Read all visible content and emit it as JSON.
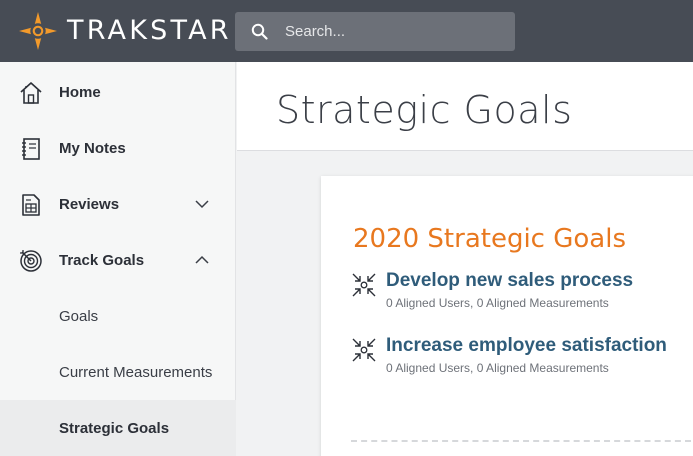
{
  "header": {
    "brand": "TRAKSTAR",
    "search_placeholder": "Search...",
    "colors": {
      "bar": "#474c55",
      "logo": "#f39a2b"
    }
  },
  "sidebar": {
    "items": [
      {
        "label": "Home",
        "icon": "home-icon"
      },
      {
        "label": "My Notes",
        "icon": "notebook-icon"
      },
      {
        "label": "Reviews",
        "icon": "review-icon",
        "chevron": "chevron-down-icon"
      },
      {
        "label": "Track Goals",
        "icon": "target-icon",
        "chevron": "chevron-up-icon"
      }
    ],
    "subitems": [
      {
        "label": "Goals"
      },
      {
        "label": "Current Measurements"
      },
      {
        "label": "Strategic Goals",
        "active": true
      }
    ]
  },
  "main": {
    "page_title": "Strategic Goals",
    "card": {
      "title": "2020 Strategic Goals",
      "title_color": "#e8781f",
      "goals": [
        {
          "name": "Develop new sales process",
          "meta": "0 Aligned Users, 0 Aligned Measurements",
          "icon": "align-arrows-icon"
        },
        {
          "name": "Increase employee satisfaction",
          "meta": "0 Aligned Users, 0 Aligned Measurements",
          "icon": "align-arrows-icon"
        }
      ]
    }
  }
}
